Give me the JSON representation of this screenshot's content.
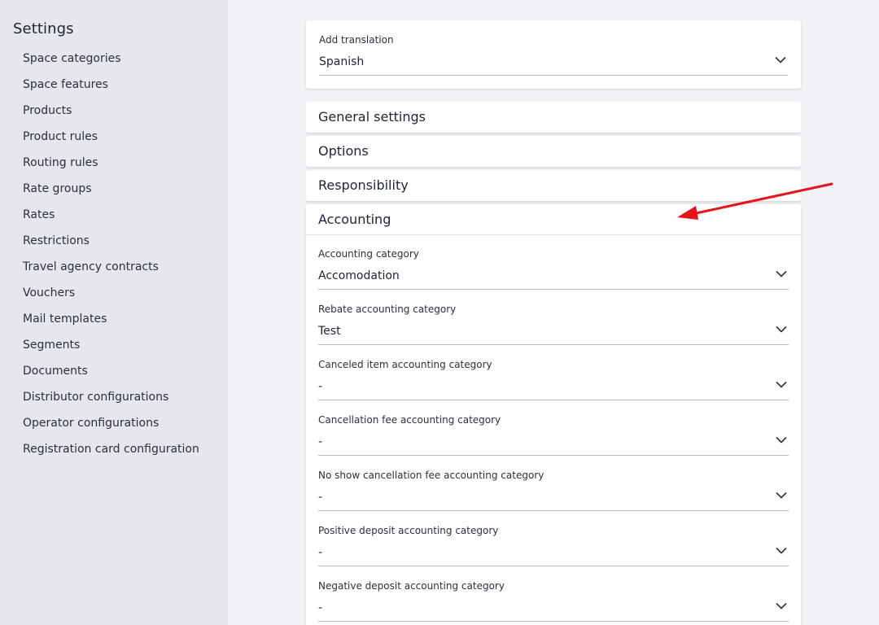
{
  "sidebar": {
    "title": "Settings",
    "items": [
      {
        "label": "Space categories"
      },
      {
        "label": "Space features"
      },
      {
        "label": "Products"
      },
      {
        "label": "Product rules"
      },
      {
        "label": "Routing rules"
      },
      {
        "label": "Rate groups"
      },
      {
        "label": "Rates"
      },
      {
        "label": "Restrictions"
      },
      {
        "label": "Travel agency contracts"
      },
      {
        "label": "Vouchers"
      },
      {
        "label": "Mail templates"
      },
      {
        "label": "Segments"
      },
      {
        "label": "Documents"
      },
      {
        "label": "Distributor configurations"
      },
      {
        "label": "Operator configurations"
      },
      {
        "label": "Registration card configuration"
      }
    ]
  },
  "translation": {
    "label": "Add translation",
    "value": "Spanish"
  },
  "sections": {
    "general": "General settings",
    "options": "Options",
    "responsibility": "Responsibility",
    "accounting": "Accounting"
  },
  "accounting_fields": [
    {
      "label": "Accounting category",
      "value": "Accomodation"
    },
    {
      "label": "Rebate accounting category",
      "value": "Test"
    },
    {
      "label": "Canceled item accounting category",
      "value": "-"
    },
    {
      "label": "Cancellation fee accounting category",
      "value": "-"
    },
    {
      "label": "No show cancellation fee accounting category",
      "value": "-"
    },
    {
      "label": "Positive deposit accounting category",
      "value": "-"
    },
    {
      "label": "Negative deposit accounting category",
      "value": "-"
    }
  ],
  "colors": {
    "annotation_arrow": "#e8141b",
    "sidebar_bg": "#e6e7ec",
    "page_bg": "#f1f2f6"
  },
  "icons": {
    "dropdown": "chevron-down-icon"
  }
}
